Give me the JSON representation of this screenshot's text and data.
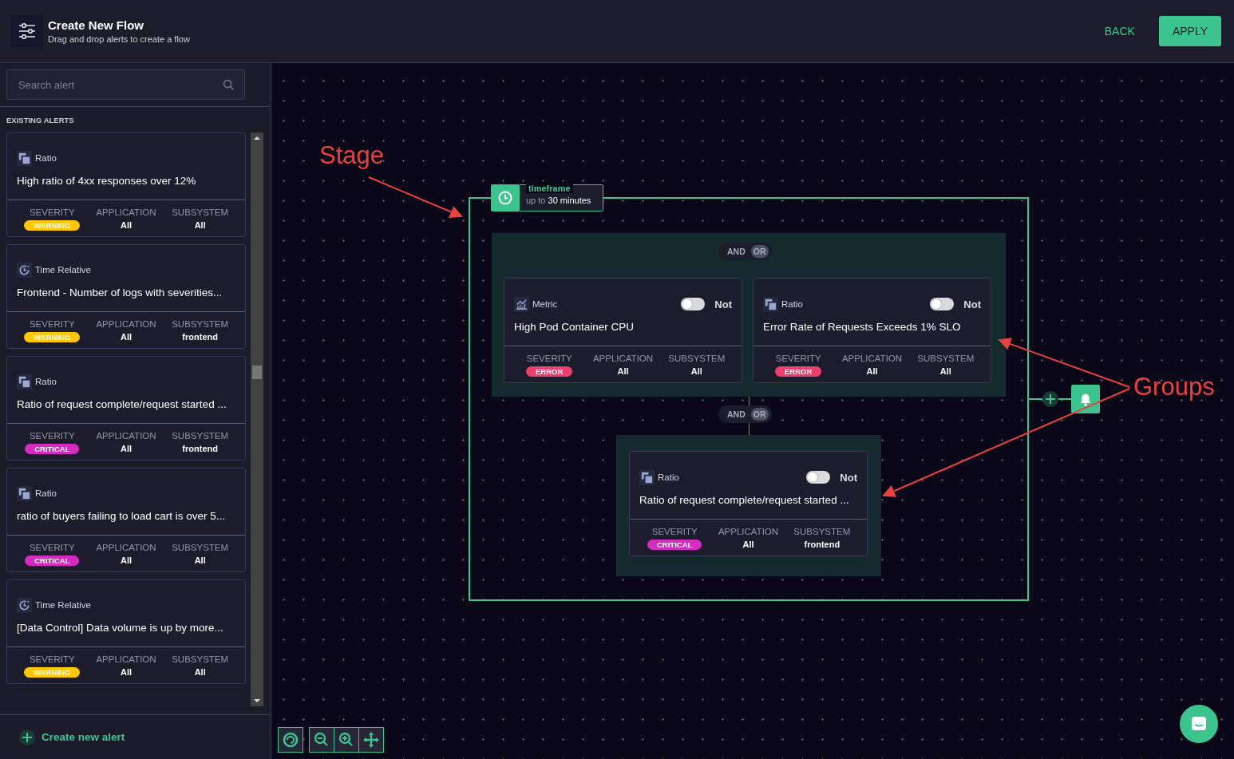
{
  "header": {
    "title": "Create New Flow",
    "subtitle": "Drag and drop alerts to create a flow",
    "actions": [
      {
        "label": "BACK",
        "kind": "text"
      },
      {
        "label": "APPLY",
        "kind": "primary"
      }
    ]
  },
  "sidebar": {
    "search": {
      "placeholder": "Search alert"
    },
    "section_title": "EXISTING ALERTS",
    "alerts": [
      {
        "kind": "ratio",
        "type": "Ratio",
        "title": "High ratio of 4xx responses over 12%",
        "columns": [
          "SEVERITY",
          "APPLICATION",
          "SUBSYSTEM"
        ],
        "severity": {
          "label": "WARNING",
          "color": "#ffc800"
        },
        "application": "All",
        "subsystem": "All"
      },
      {
        "kind": "time",
        "type": "Time Relative",
        "title": "Frontend - Number of logs with severities...",
        "columns": [
          "SEVERITY",
          "APPLICATION",
          "SUBSYSTEM"
        ],
        "severity": {
          "label": "WARNING",
          "color": "#ffc800"
        },
        "application": "All",
        "subsystem": "frontend"
      },
      {
        "kind": "ratio",
        "type": "Ratio",
        "title": "Ratio of request complete/request started ...",
        "columns": [
          "SEVERITY",
          "APPLICATION",
          "SUBSYSTEM"
        ],
        "severity": {
          "label": "CRITICAL",
          "color": "#d42bc2"
        },
        "application": "All",
        "subsystem": "frontend"
      },
      {
        "kind": "ratio",
        "type": "Ratio",
        "title": "ratio of buyers failing to load cart is over 5...",
        "columns": [
          "SEVERITY",
          "APPLICATION",
          "SUBSYSTEM"
        ],
        "severity": {
          "label": "CRITICAL",
          "color": "#d42bc2"
        },
        "application": "All",
        "subsystem": "All"
      },
      {
        "kind": "time",
        "type": "Time Relative",
        "title": "[Data Control] Data volume is up by more...",
        "columns": [
          "SEVERITY",
          "APPLICATION",
          "SUBSYSTEM"
        ],
        "severity": {
          "label": "WARNING",
          "color": "#ffc800"
        },
        "application": "All",
        "subsystem": "All"
      }
    ],
    "create_button": "Create new alert"
  },
  "canvas": {
    "timeframe": {
      "label": "timeframe",
      "prefix": "up to",
      "value": "30 minutes"
    },
    "groups": [
      {
        "operators": [
          {
            "label": "AND",
            "selected": false
          },
          {
            "label": "OR",
            "selected": true
          }
        ],
        "cards": [
          {
            "kind": "metric",
            "type": "Metric",
            "not_label": "Not",
            "not_on": false,
            "title": "High Pod Container CPU",
            "columns": [
              "SEVERITY",
              "APPLICATION",
              "SUBSYSTEM"
            ],
            "severity": {
              "label": "ERROR",
              "color": "#ec3f6e"
            },
            "application": "All",
            "subsystem": "All"
          },
          {
            "kind": "ratio",
            "type": "Ratio",
            "not_label": "Not",
            "not_on": false,
            "title": "Error Rate of Requests Exceeds 1% SLO",
            "columns": [
              "SEVERITY",
              "APPLICATION",
              "SUBSYSTEM"
            ],
            "severity": {
              "label": "ERROR",
              "color": "#ec3f6e"
            },
            "application": "All",
            "subsystem": "All"
          }
        ]
      },
      {
        "operators": [
          {
            "label": "AND",
            "selected": false
          },
          {
            "label": "OR",
            "selected": true
          }
        ],
        "cards": [
          {
            "kind": "ratio",
            "type": "Ratio",
            "not_label": "Not",
            "not_on": false,
            "title": "Ratio of request complete/request started ...",
            "columns": [
              "SEVERITY",
              "APPLICATION",
              "SUBSYSTEM"
            ],
            "severity": {
              "label": "CRITICAL",
              "color": "#d42bc2"
            },
            "application": "All",
            "subsystem": "frontend"
          }
        ]
      }
    ],
    "annotations": [
      {
        "text": "Stage"
      },
      {
        "text": "Groups"
      }
    ]
  }
}
